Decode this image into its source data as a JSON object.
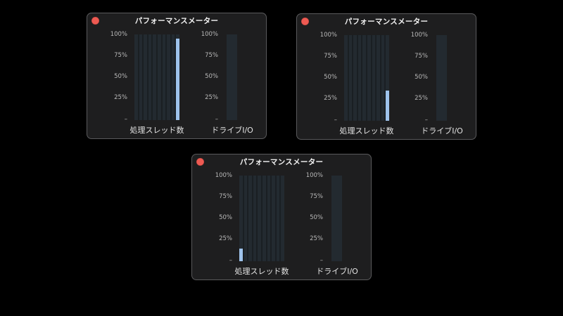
{
  "windows": [
    {
      "title": "パフォーマンスメーター",
      "threads_label": "処理スレッド数",
      "io_label": "ドライブI/O",
      "thread_levels": [
        0,
        0,
        0,
        0,
        0,
        0,
        0,
        0,
        0,
        0.95
      ],
      "io_level": 0
    },
    {
      "title": "パフォーマンスメーター",
      "threads_label": "処理スレッド数",
      "io_label": "ドライブI/O",
      "thread_levels": [
        0,
        0,
        0,
        0,
        0,
        0,
        0,
        0,
        0,
        0.35
      ],
      "io_level": 0
    },
    {
      "title": "パフォーマンスメーター",
      "threads_label": "処理スレッド数",
      "io_label": "ドライブI/O",
      "thread_levels": [
        0.15,
        0,
        0,
        0,
        0,
        0,
        0,
        0,
        0,
        0
      ],
      "io_level": 0
    }
  ],
  "ticks": [
    "100%",
    "75%",
    "50%",
    "25%",
    "–"
  ],
  "colors": {
    "fill": "#9ec3ec",
    "track": "#232a30",
    "close": "#ee5a52"
  },
  "icons": {
    "close": "close-button-red-dot"
  }
}
